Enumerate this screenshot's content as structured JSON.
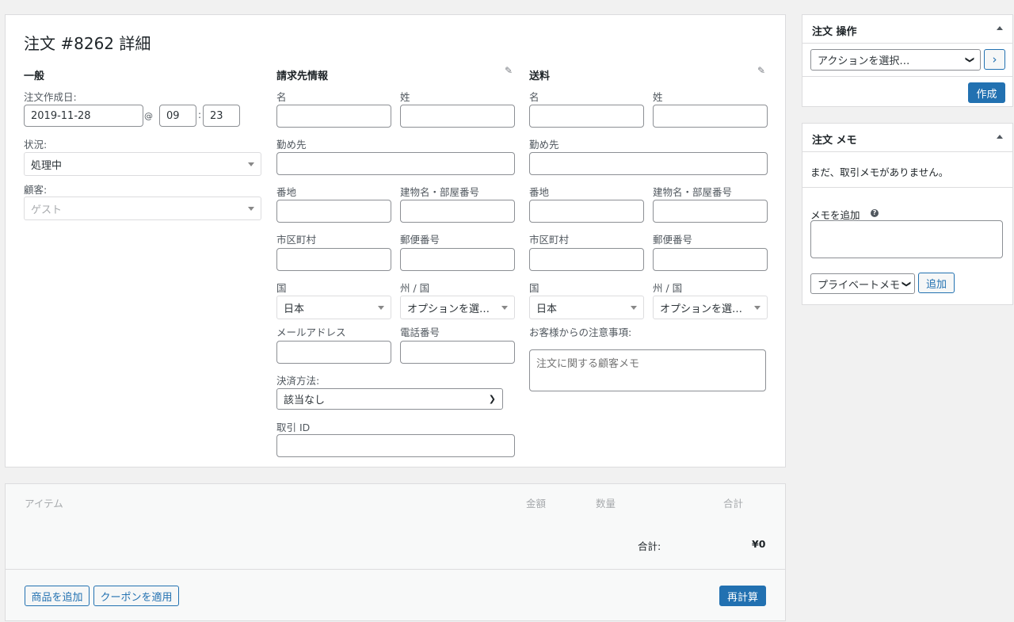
{
  "order": {
    "title": "注文 #8262 詳細",
    "general": {
      "heading": "一般",
      "date_label": "注文作成日:",
      "date_value": "2019-11-28",
      "at": "@",
      "hour": "09",
      "colon": ":",
      "minute": "23",
      "status_label": "状況:",
      "status_value": "処理中",
      "customer_label": "顧客:",
      "customer_value": "ゲスト"
    },
    "billing": {
      "heading": "請求先情報",
      "first_name": "名",
      "last_name": "姓",
      "company": "勤め先",
      "address1": "番地",
      "address2": "建物名・部屋番号",
      "city": "市区町村",
      "postcode": "郵便番号",
      "country_label": "国",
      "country_value": "日本",
      "state_label": "州 / 国",
      "state_value": "オプションを選択…",
      "email": "メールアドレス",
      "phone": "電話番号",
      "payment_label": "決済方法:",
      "payment_value": "該当なし",
      "transaction_label": "取引 ID"
    },
    "shipping": {
      "heading": "送料",
      "first_name": "名",
      "last_name": "姓",
      "company": "勤め先",
      "address1": "番地",
      "address2": "建物名・部屋番号",
      "city": "市区町村",
      "postcode": "郵便番号",
      "country_label": "国",
      "country_value": "日本",
      "state_label": "州 / 国",
      "state_value": "オプションを選択…",
      "note_label": "お客様からの注意事項:",
      "note_placeholder": "注文に関する顧客メモ"
    }
  },
  "items": {
    "col_item": "アイテム",
    "col_cost": "金額",
    "col_qty": "数量",
    "col_total": "合計",
    "total_label": "合計:",
    "total_value": "¥0",
    "add_product": "商品を追加",
    "apply_coupon": "クーポンを適用",
    "recalculate": "再計算"
  },
  "actions_box": {
    "title": "注文 操作",
    "select_value": "アクションを選択…",
    "go": "›",
    "create": "作成"
  },
  "notes_box": {
    "title": "注文 メモ",
    "empty": "まだ、取引メモがありません。",
    "add_label": "メモを追加",
    "help": "?",
    "type_value": "プライベートメモ",
    "add_button": "追加"
  },
  "icons": {
    "edit": "pencil-icon",
    "collapse": "triangle-up-icon",
    "help": "help-circle-icon"
  },
  "colors": {
    "primary": "#2271b1",
    "border": "#dcdcde",
    "background": "#f1f1f1"
  }
}
